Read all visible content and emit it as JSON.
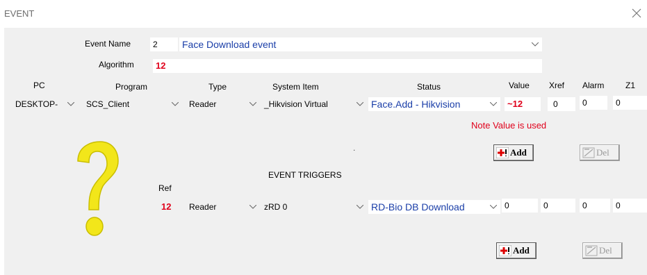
{
  "window": {
    "title": "EVENT"
  },
  "form": {
    "event_name_label": "Event Name",
    "event_name_index": "2",
    "event_name_value": "Face Download event",
    "algorithm_label": "Algorithm",
    "algorithm_value": "12"
  },
  "columns": {
    "pc": "PC",
    "program": "Program",
    "type": "Type",
    "system_item": "System Item",
    "status": "Status",
    "value": "Value",
    "xref": "Xref",
    "alarm": "Alarm",
    "z1": "Z1"
  },
  "event_row": {
    "pc": "DESKTOP-",
    "program": "SCS_Client",
    "type": "Reader",
    "system_item": "_Hikvision Virtual",
    "status": "Face.Add - Hikvision",
    "value": "~12",
    "xref": "0",
    "alarm": "0",
    "z1": "0"
  },
  "note": "Note Value is used",
  "dot": ".",
  "add_label": "Add",
  "del_label": "Del",
  "triggers": {
    "heading": "EVENT TRIGGERS",
    "ref_label": "Ref",
    "ref_value": "12",
    "type": "Reader",
    "system_item": "zRD 0",
    "status": "RD-Bio DB Download",
    "value": "0",
    "xref": "0",
    "alarm": "0",
    "z1": "0"
  },
  "colors": {
    "accent_red": "#e0001b",
    "link_blue": "#1a3ea8",
    "panel_bg": "#f0f0f0"
  },
  "icons": [
    "close-icon",
    "question-mark-icon",
    "add-icon",
    "delete-icon",
    "dropdown-arrow-icon"
  ]
}
